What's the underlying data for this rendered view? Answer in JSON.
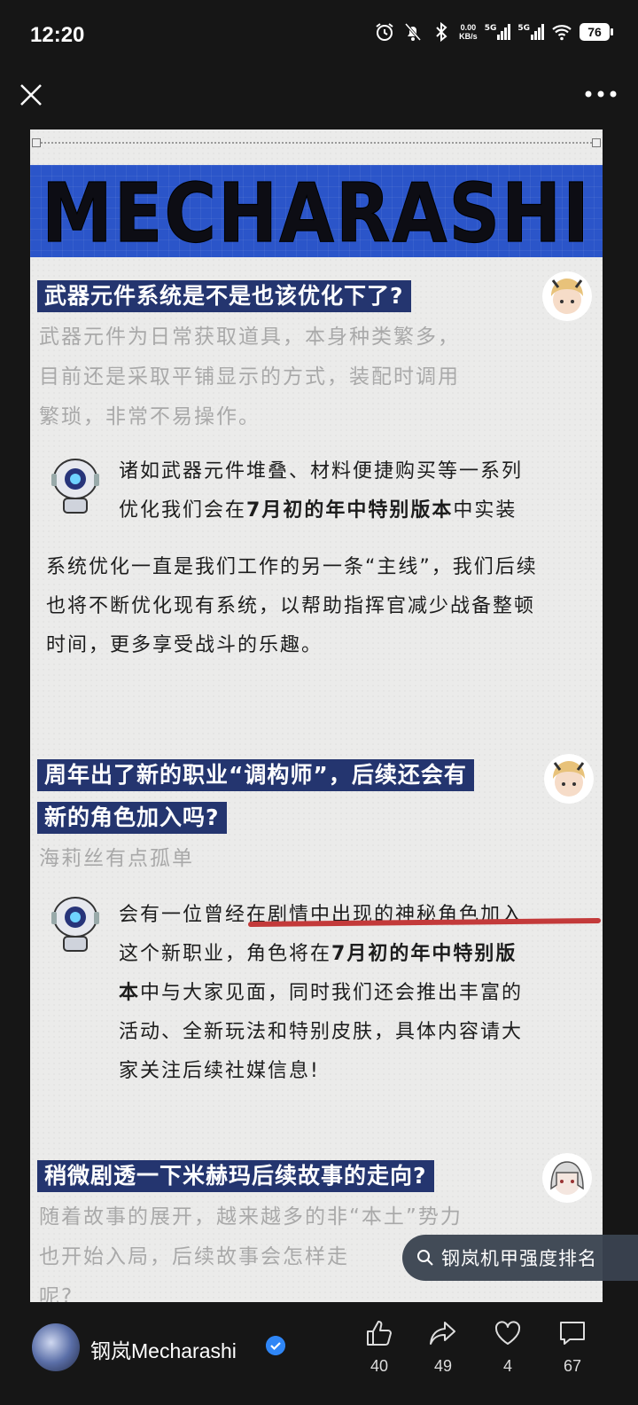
{
  "status_bar": {
    "time": "12:20",
    "net_speed_value": "0.00",
    "net_speed_unit": "KB/s",
    "sim1": "5G",
    "sim2": "5G",
    "battery": "76"
  },
  "article": {
    "banner": "MECHARASHI",
    "sections": [
      {
        "question_lines": [
          "武器元件系统是不是也该优化下了?"
        ],
        "intro_lines": [
          "武器元件为日常获取道具，本身种类繁多，",
          "目前还是采取平铺显示的方式，装配时调用",
          "繁琐，非常不易操作。"
        ],
        "answer_lines": [
          {
            "a": "诸如武器元件堆叠、材料便捷购买等一系列",
            "b": "",
            "c": ""
          },
          {
            "a": "优化我们会在",
            "b": "7月初的年中特别版本",
            "c": "中实装"
          }
        ],
        "note_lines": [
          "系统优化一直是我们工作的另一条“主线”，我们后续",
          "也将不断优化现有系统，以帮助指挥官减少战备整顿",
          "时间，更多享受战斗的乐趣。"
        ]
      },
      {
        "question_lines": [
          "周年出了新的职业“调构师”，后续还会有",
          "新的角色加入吗?"
        ],
        "intro_lines": [
          "海莉丝有点孤单"
        ],
        "answer_lines": [
          {
            "a": "会有一位曾经在剧情中出现的神秘角色加入",
            "b": "",
            "c": ""
          },
          {
            "a": "这个新职业，角色将在",
            "b": "7月初的年中特别版",
            "c": ""
          },
          {
            "a": "",
            "b": "本",
            "c": "中与大家见面，同时我们还会推出丰富的"
          },
          {
            "a": "活动、全新玩法和特别皮肤，具体内容请大",
            "b": "",
            "c": ""
          },
          {
            "a": "家关注后续社媒信息!",
            "b": "",
            "c": ""
          }
        ]
      },
      {
        "question_lines": [
          "稍微剧透一下米赫玛后续故事的走向?"
        ],
        "intro_lines": [
          "随着故事的展开，越来越多的非“本土”势力",
          "也开始入局，后续故事会怎样走",
          "呢?"
        ]
      }
    ]
  },
  "search_chip": "钢岚机甲强度排名",
  "author": {
    "name": "钢岚Mecharashi"
  },
  "actions": {
    "like": "40",
    "share": "49",
    "favorite": "4",
    "comment": "67"
  }
}
